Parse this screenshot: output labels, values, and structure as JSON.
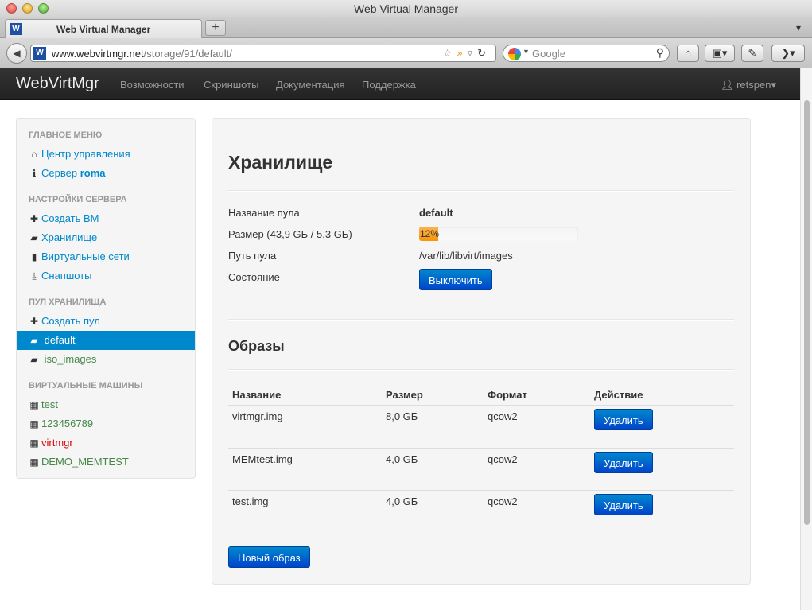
{
  "browser": {
    "window_title": "Web Virtual Manager",
    "tab_title": "Web Virtual Manager",
    "favicon_letter": "W",
    "url_host": "www.webvirtmgr.net",
    "url_path": "/storage/91/default/",
    "search_placeholder": "Google",
    "new_tab_label": "+"
  },
  "navbar": {
    "brand": "WebVirtMgr",
    "links": [
      "Возможности",
      "Скриншоты",
      "Документация",
      "Поддержка"
    ],
    "user": "retspen"
  },
  "sidebar": {
    "main_header": "ГЛАВНОЕ МЕНЮ",
    "main_items": [
      {
        "label": "Центр управления"
      },
      {
        "label": "Сервер ",
        "bold": "roma"
      }
    ],
    "server_header": "НАСТРОЙКИ СЕРВЕРА",
    "server_items": [
      {
        "label": "Создать ВМ"
      },
      {
        "label": "Хранилище"
      },
      {
        "label": "Виртуальные сети"
      },
      {
        "label": "Снапшоты"
      }
    ],
    "pool_header": "ПУЛ ХРАНИЛИЩА",
    "pool_items": [
      {
        "label": "Создать пул"
      },
      {
        "label": "default"
      },
      {
        "label": "iso_images"
      }
    ],
    "vm_header": "ВИРТУАЛЬНЫЕ МАШИНЫ",
    "vm_items": [
      {
        "label": "test",
        "state": "running"
      },
      {
        "label": "123456789",
        "state": "running"
      },
      {
        "label": "virtmgr",
        "state": "stopped"
      },
      {
        "label": "DEMO_MEMTEST",
        "state": "running"
      }
    ]
  },
  "storage": {
    "title": "Хранилище",
    "pool_name_label": "Название пула",
    "pool_name": "default",
    "size_label": "Размер (43,9 GБ / 5,3 GБ)",
    "usage_percent": 12,
    "usage_text": "12%",
    "path_label": "Путь пула",
    "path": "/var/lib/libvirt/images",
    "state_label": "Состояние",
    "stop_button": "Выключить"
  },
  "images": {
    "title": "Образы",
    "columns": [
      "Название",
      "Размер",
      "Формат",
      "Действие"
    ],
    "rows": [
      {
        "name": "virtmgr.img",
        "size": "8,0 GБ",
        "format": "qcow2",
        "action": "Удалить"
      },
      {
        "name": "MEMtest.img",
        "size": "4,0 GБ",
        "format": "qcow2",
        "action": "Удалить"
      },
      {
        "name": "test.img",
        "size": "4,0 GБ",
        "format": "qcow2",
        "action": "Удалить"
      }
    ],
    "new_button": "Новый образ"
  },
  "colors": {
    "link": "#0088cc",
    "running": "#468847",
    "stopped": "#e00000",
    "progress": "#f89406"
  }
}
